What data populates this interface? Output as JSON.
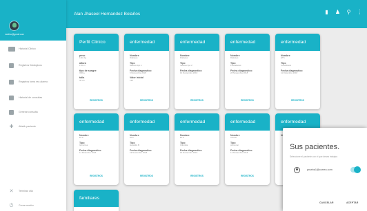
{
  "topbar": {
    "title": "Alan Jhaseel Hernandez Bolaños",
    "icons": [
      "card-icon",
      "people-icon",
      "search-icon",
      "more-vert-icon"
    ]
  },
  "sidebar": {
    "email": "medico@gmail.com",
    "items": [
      {
        "label": "Historial Clinico",
        "icon": "id-card-icon"
      },
      {
        "label": "Registros fisiologicos",
        "icon": "clipboard-icon"
      },
      {
        "label": "Registros toma rea alarmo",
        "icon": "clipboard-icon"
      },
      {
        "label": "Historial de consultas",
        "icon": "calendar-icon"
      },
      {
        "label": "Generar consulta",
        "icon": "calendar-icon"
      },
      {
        "label": "Añadir paciente",
        "icon": "add-person-icon"
      }
    ],
    "bottom_items": [
      {
        "label": "Terminar cita",
        "icon": "close-icon"
      },
      {
        "label": "Cerrar sesión",
        "icon": "power-icon"
      }
    ]
  },
  "cards_row1": [
    {
      "header": "Perfil Clinico",
      "fields": [
        {
          "label": "peso",
          "value": "1111 Kg"
        },
        {
          "label": "altura",
          "value": "1.80 m"
        },
        {
          "label": "tipo de sangre",
          "value": "ORH+"
        },
        {
          "label": "talla",
          "value": "30 cm"
        }
      ],
      "button": "REGISTROS"
    },
    {
      "header": "enfermedad",
      "fields": [
        {
          "label": "Nombre",
          "value": "Diabetes"
        },
        {
          "label": "Tipo",
          "value": "Mellitus tipo 1"
        },
        {
          "label": "Fecha diagnostico",
          "value": "6 Noviembre 2018"
        },
        {
          "label": "Valor inicial",
          "value": "120"
        }
      ],
      "button": "REGISTROS"
    },
    {
      "header": "enfermedad",
      "fields": [
        {
          "label": "Nombre",
          "value": "Diabetes"
        },
        {
          "label": "Tipo",
          "value": "mellitus tipo 2"
        },
        {
          "label": "Fecha diagnostico",
          "value": "13 Noviembre 2018"
        }
      ],
      "button": "REGISTROS"
    },
    {
      "header": "enfermedad",
      "fields": [
        {
          "label": "Nombre",
          "value": "Diabetes"
        },
        {
          "label": "Tipo",
          "value": "Prediabetes"
        },
        {
          "label": "Fecha diagnostico",
          "value": "28 Noviembre 2018"
        }
      ],
      "button": "REGISTROS"
    },
    {
      "header": "enfermedad",
      "fields": [
        {
          "label": "Nombre",
          "value": "ETS"
        },
        {
          "label": "Tipo",
          "value": "Candidiasis"
        },
        {
          "label": "Fecha diagnostico",
          "value": "11 Diciembre 2018"
        }
      ],
      "button": "REGISTROS"
    }
  ],
  "cards_row2": [
    {
      "header": "enfermedad",
      "fields": [
        {
          "label": "Nombre",
          "value": "ETS"
        },
        {
          "label": "Tipo",
          "value": "Gonorrea"
        },
        {
          "label": "Fecha diagnostico",
          "value": "11 Diciembre 2018"
        }
      ],
      "button": "REGISTROS"
    },
    {
      "header": "enfermedad",
      "fields": [
        {
          "label": "Nombre",
          "value": "ETS"
        },
        {
          "label": "Tipo",
          "value": "Hepatitis B"
        },
        {
          "label": "Fecha diagnostico",
          "value": "19 Noviembre 2018"
        }
      ],
      "button": "REGISTROS"
    },
    {
      "header": "enfermedad",
      "fields": [
        {
          "label": "Nombre",
          "value": "ETS"
        },
        {
          "label": "Tipo",
          "value": "Clamidia"
        },
        {
          "label": "Fecha diagnostico",
          "value": "19 Noviembre 2018"
        }
      ],
      "button": "REGISTROS"
    },
    {
      "header": "enfermedad",
      "fields": [
        {
          "label": "Nombre",
          "value": "Cáncer"
        },
        {
          "label": "Tipo",
          "value": "pulmonar"
        },
        {
          "label": "Fecha diagnostico",
          "value": "14 Noviembre 2018"
        }
      ],
      "button": "REGISTROS"
    },
    {
      "header": "enfermedad",
      "fields": [
        {
          "label": "Nombre",
          "value": ""
        }
      ],
      "button": ""
    }
  ],
  "card_row3": {
    "header": "familiares",
    "fields": [
      {
        "label": "",
        "value": ""
      }
    ]
  },
  "modal": {
    "title": "Sus pacientes.",
    "subtitle": "Seleccione el paciente con el que desea trabajar.",
    "patient_email": "prueba1@correo.com",
    "toggle_on": true,
    "cancel": "CANCELAR",
    "accept": "ACEPTAR"
  }
}
